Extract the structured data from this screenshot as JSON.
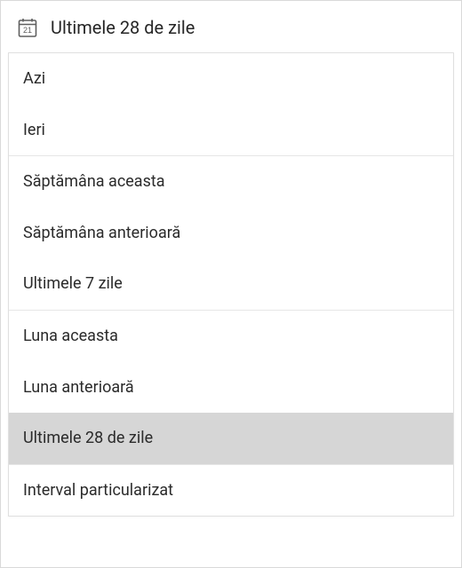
{
  "header": {
    "calendar_day": "21",
    "current_label": "Ultimele 28 de zile"
  },
  "groups": [
    {
      "items": [
        {
          "label": "Azi",
          "selected": false
        },
        {
          "label": "Ieri",
          "selected": false
        }
      ]
    },
    {
      "items": [
        {
          "label": "Săptămâna aceasta",
          "selected": false
        },
        {
          "label": "Săptămâna anterioară",
          "selected": false
        },
        {
          "label": "Ultimele 7 zile",
          "selected": false
        }
      ]
    },
    {
      "items": [
        {
          "label": "Luna aceasta",
          "selected": false
        },
        {
          "label": "Luna anterioară",
          "selected": false
        },
        {
          "label": "Ultimele 28 de zile",
          "selected": true
        }
      ]
    },
    {
      "items": [
        {
          "label": "Interval particularizat",
          "selected": false
        }
      ]
    }
  ]
}
